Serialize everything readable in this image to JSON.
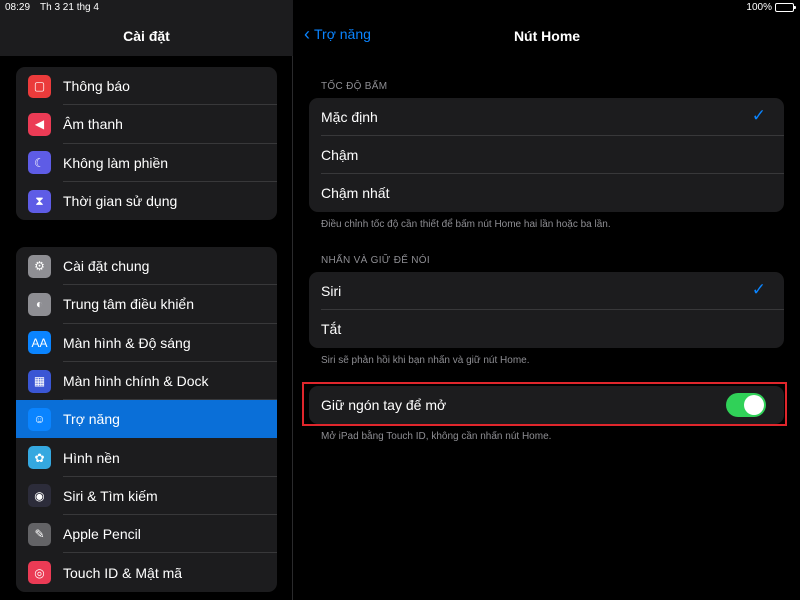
{
  "status": {
    "time": "08:29",
    "date": "Th 3 21 thg 4",
    "battery": "100%"
  },
  "sidebar": {
    "title": "Cài đặt",
    "group1": [
      {
        "label": "Thông báo",
        "icon": "bell-icon",
        "color": "#eb3b3b"
      },
      {
        "label": "Âm thanh",
        "icon": "speaker-icon",
        "color": "#eb3b55"
      },
      {
        "label": "Không làm phiền",
        "icon": "moon-icon",
        "color": "#5e5ce6"
      },
      {
        "label": "Thời gian sử dụng",
        "icon": "hourglass-icon",
        "color": "#5e5ce6"
      }
    ],
    "group2": [
      {
        "label": "Cài đặt chung",
        "icon": "gear-icon",
        "color": "#8e8e93"
      },
      {
        "label": "Trung tâm điều khiển",
        "icon": "toggles-icon",
        "color": "#8e8e93"
      },
      {
        "label": "Màn hình & Độ sáng",
        "icon": "text-size-icon",
        "color": "#0a84ff",
        "glyph": "AA"
      },
      {
        "label": "Màn hình chính & Dock",
        "icon": "grid-icon",
        "color": "#3a56d4"
      },
      {
        "label": "Trợ năng",
        "icon": "accessibility-icon",
        "color": "#0a84ff",
        "active": true
      },
      {
        "label": "Hình nền",
        "icon": "flower-icon",
        "color": "#35a8e0"
      },
      {
        "label": "Siri & Tìm kiếm",
        "icon": "siri-icon",
        "color": "#2c2c3a"
      },
      {
        "label": "Apple Pencil",
        "icon": "pencil-icon",
        "color": "#636366"
      },
      {
        "label": "Touch ID & Mật mã",
        "icon": "fingerprint-icon",
        "color": "#eb3b55"
      }
    ]
  },
  "main": {
    "back_label": "Trợ năng",
    "title": "Nút Home",
    "section1": {
      "header": "TỐC ĐỘ BẤM",
      "options": [
        "Mặc định",
        "Chậm",
        "Chậm nhất"
      ],
      "selected": 0,
      "footer": "Điều chỉnh tốc độ cần thiết để bấm nút Home hai lần hoặc ba lần."
    },
    "section2": {
      "header": "NHẤN VÀ GIỮ ĐỂ NÓI",
      "options": [
        "Siri",
        "Tắt"
      ],
      "selected": 0,
      "footer": "Siri sẽ phản hồi khi bạn nhấn và giữ nút Home."
    },
    "section3": {
      "label": "Giữ ngón tay để mở",
      "toggle_on": true,
      "footer": "Mở iPad bằng Touch ID, không cần nhấn nút Home."
    }
  },
  "colors": {
    "accent": "#0a84ff",
    "toggle_on": "#30d158",
    "highlight": "#e0262c"
  }
}
